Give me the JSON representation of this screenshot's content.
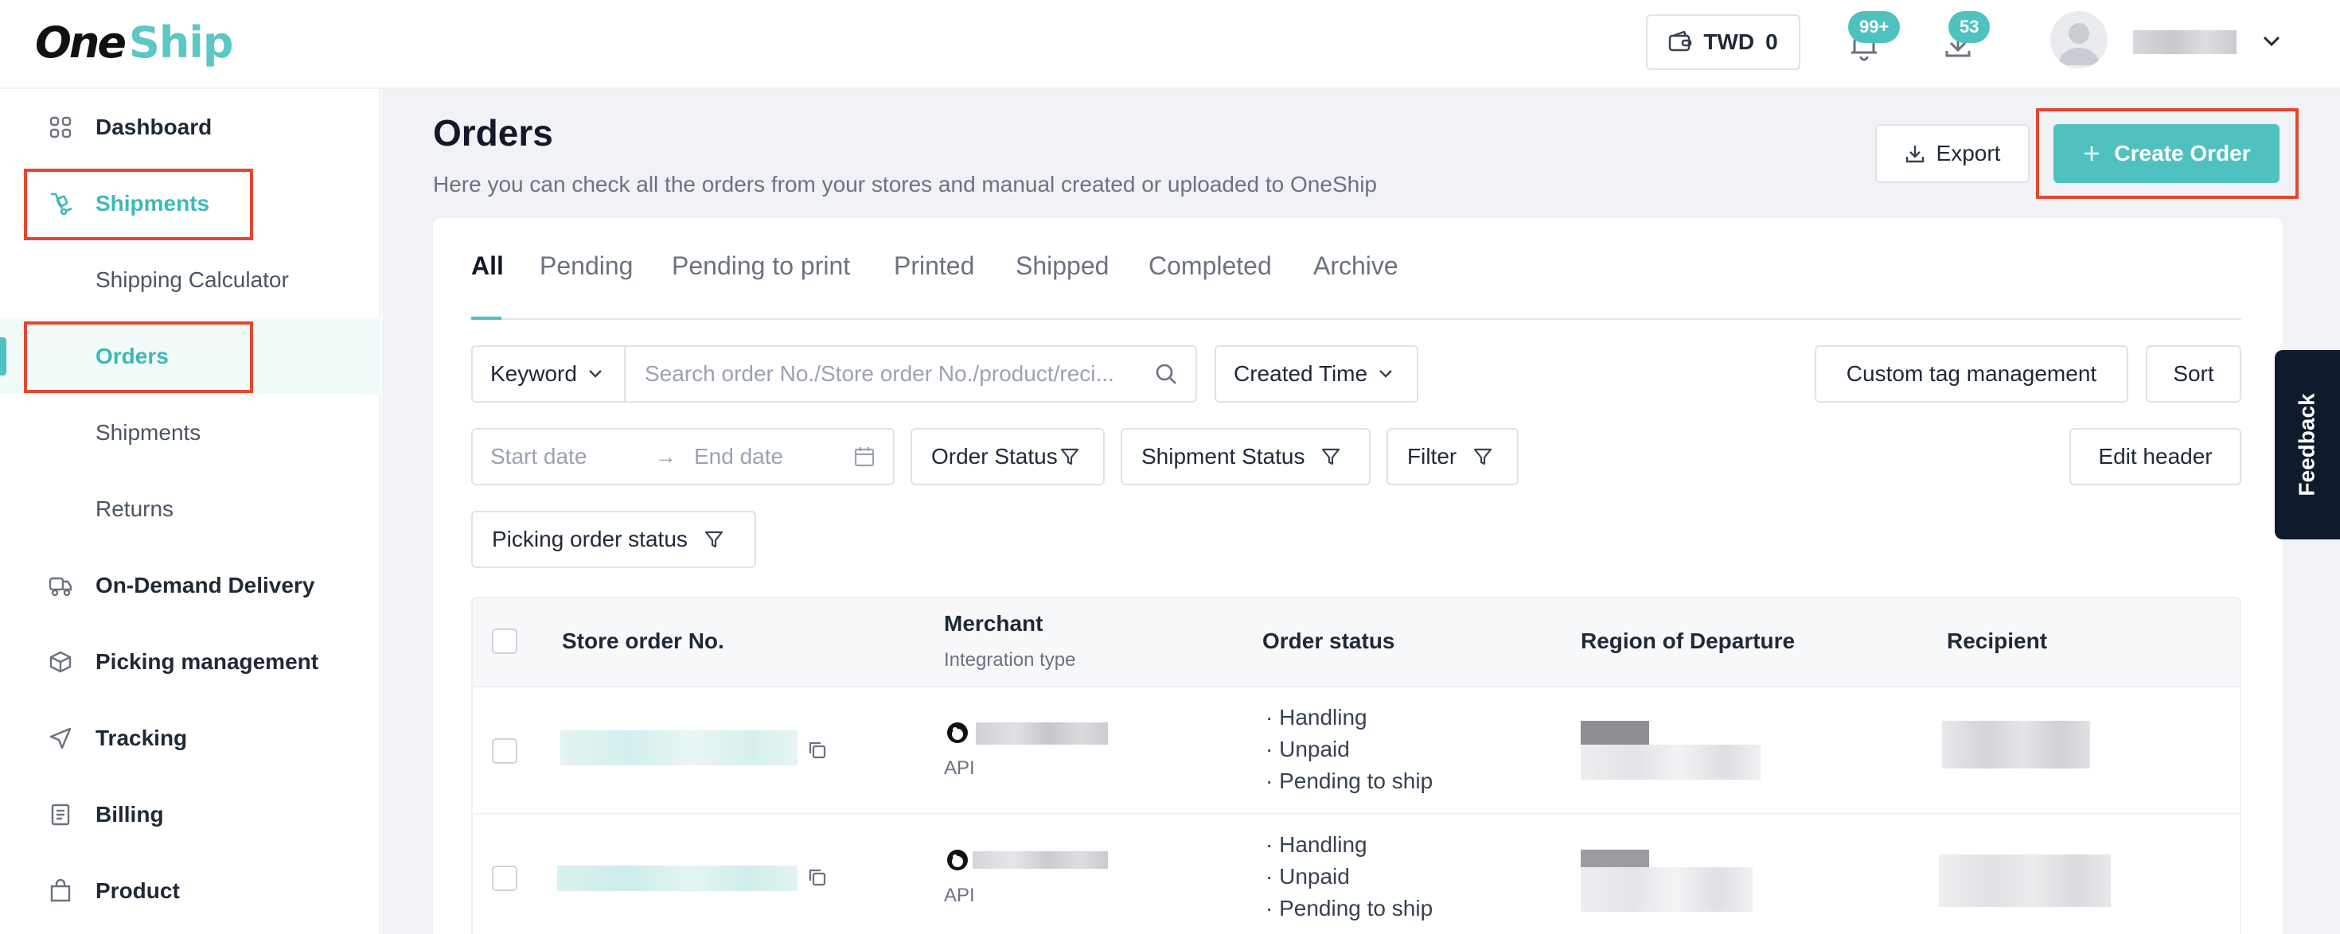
{
  "brand": {
    "part1": "One",
    "part2": "Ship"
  },
  "header": {
    "wallet_label": "TWD",
    "wallet_value": "0",
    "notifications_badge": "99+",
    "downloads_badge": "53"
  },
  "sidebar": {
    "items": [
      {
        "label": "Dashboard"
      },
      {
        "label": "Shipments"
      },
      {
        "label": "Shipping Calculator"
      },
      {
        "label": "Orders"
      },
      {
        "label": "Shipments"
      },
      {
        "label": "Returns"
      },
      {
        "label": "On-Demand Delivery"
      },
      {
        "label": "Picking management"
      },
      {
        "label": "Tracking"
      },
      {
        "label": "Billing"
      },
      {
        "label": "Product"
      }
    ]
  },
  "page": {
    "title": "Orders",
    "subtitle": "Here you can check all the orders from your stores and manual created or uploaded to OneShip",
    "export_label": "Export",
    "create_label": "Create Order"
  },
  "tabs": [
    "All",
    "Pending",
    "Pending to print",
    "Printed",
    "Shipped",
    "Completed",
    "Archive"
  ],
  "filters": {
    "keyword_label": "Keyword",
    "search_placeholder": "Search order No./Store order No./product/reci...",
    "created_time_label": "Created Time",
    "custom_tag_label": "Custom tag management",
    "sort_label": "Sort",
    "start_date_placeholder": "Start date",
    "end_date_placeholder": "End date",
    "order_status_label": "Order Status",
    "shipment_status_label": "Shipment Status",
    "filter_label": "Filter",
    "edit_header_label": "Edit header",
    "picking_status_label": "Picking order status"
  },
  "table": {
    "columns": {
      "store_order": "Store order No.",
      "merchant": "Merchant",
      "merchant_sub": "Integration type",
      "order_status": "Order status",
      "region": "Region of Departure",
      "recipient": "Recipient"
    },
    "rows": [
      {
        "integration": "API",
        "statuses": [
          "· Handling",
          "· Unpaid",
          "· Pending to ship"
        ]
      },
      {
        "integration": "API",
        "statuses": [
          "· Handling",
          "· Unpaid",
          "· Pending to ship"
        ]
      }
    ]
  },
  "feedback_label": "Feedback",
  "colors": {
    "accent": "#4fc1bf",
    "highlight_box": "#e3472f",
    "dark": "#0f1b2d"
  }
}
